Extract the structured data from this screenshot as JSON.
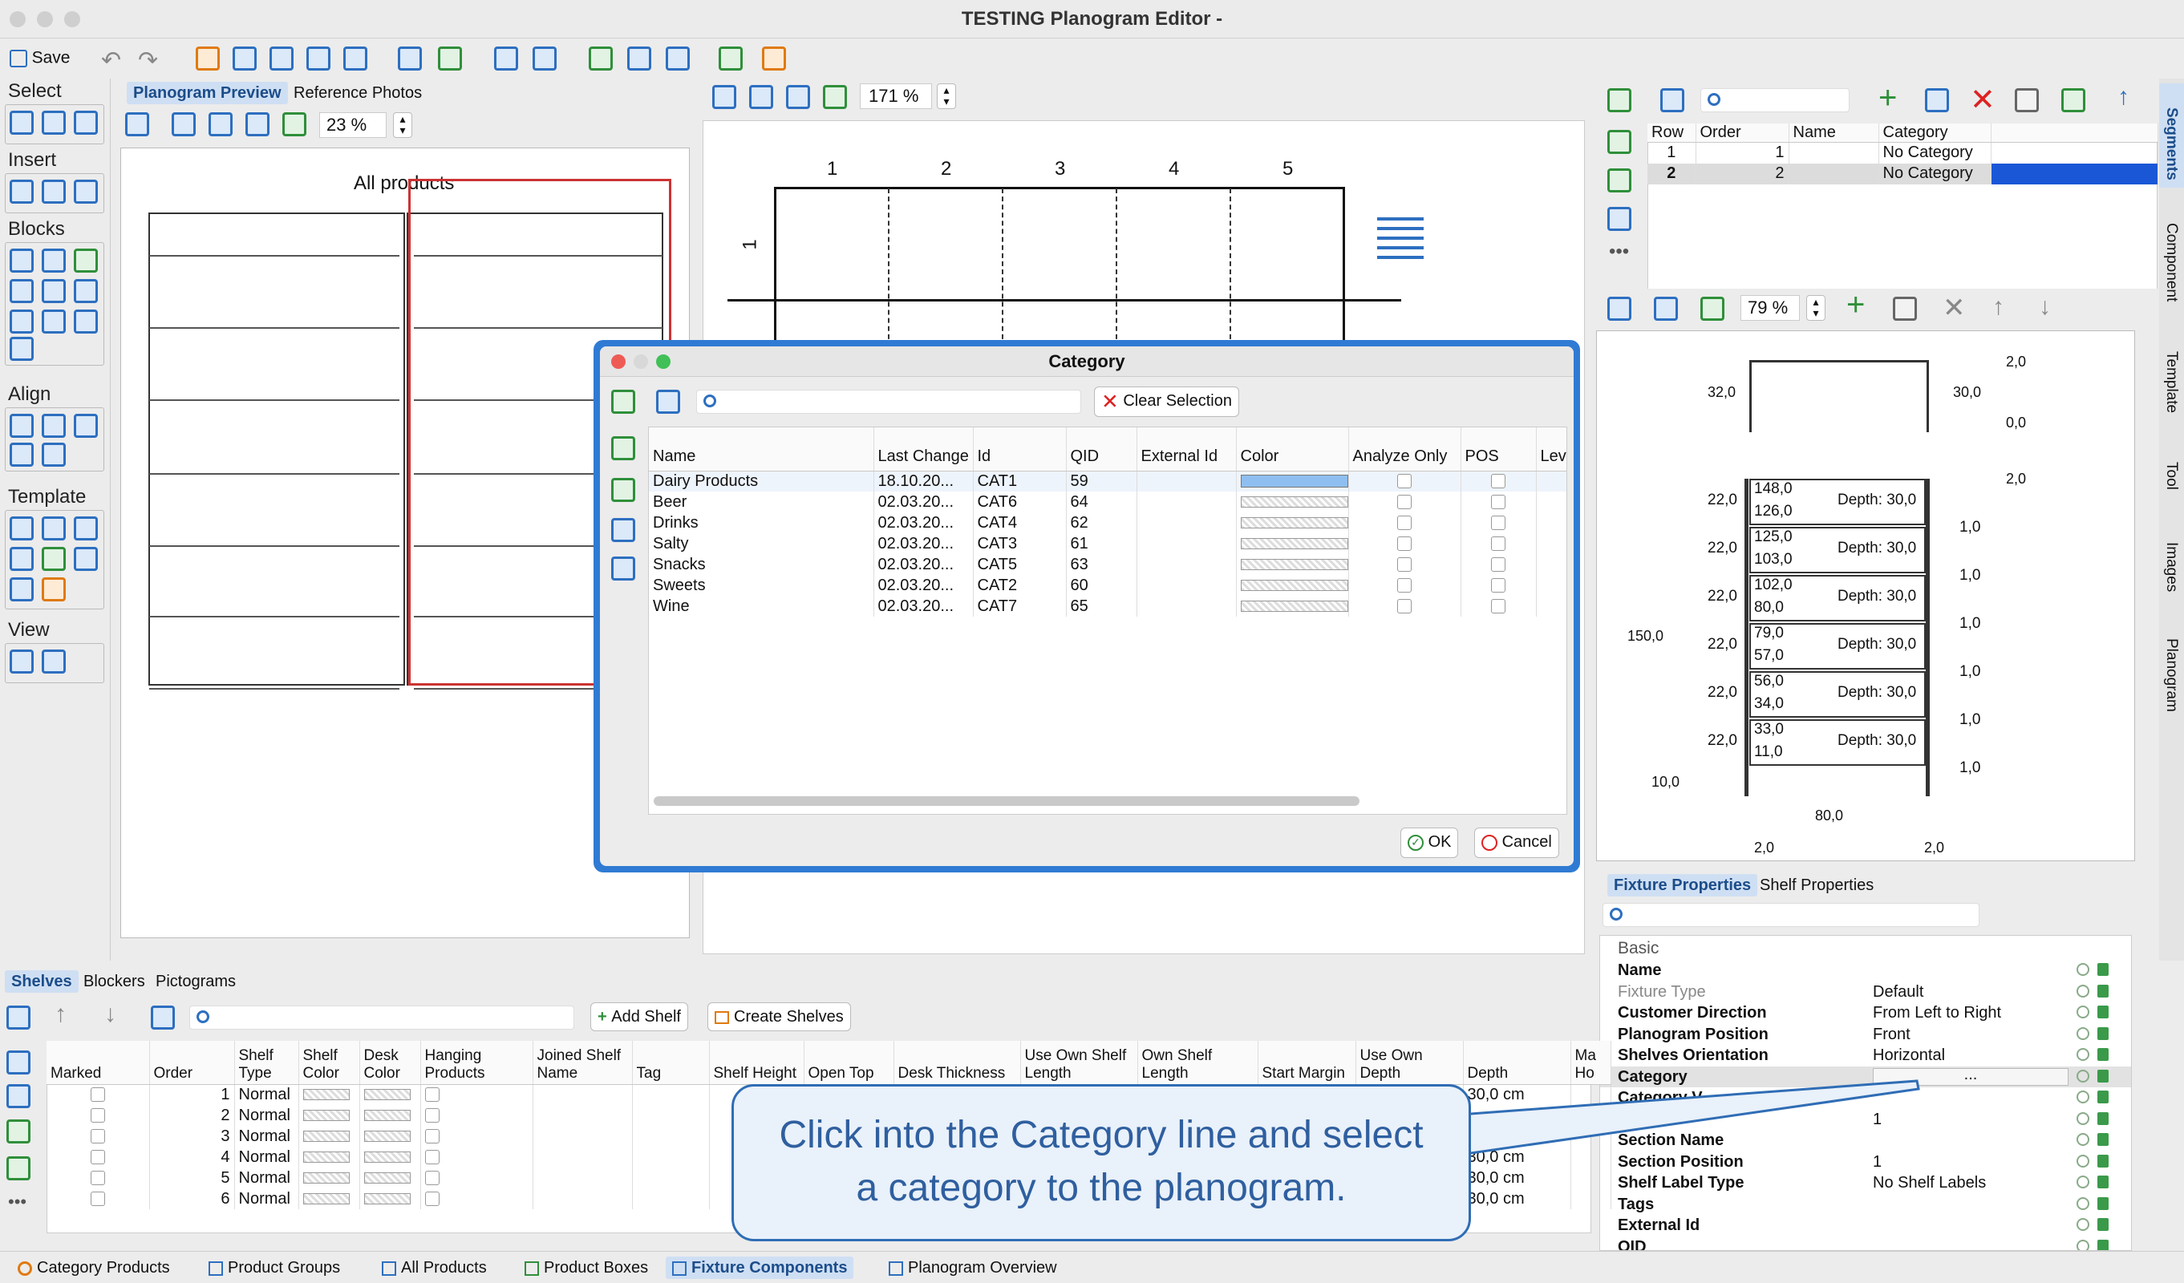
{
  "window": {
    "title": "TESTING Planogram Editor -"
  },
  "toolbar": {
    "save": "Save"
  },
  "left_palette": {
    "groups": [
      "Select",
      "Insert",
      "Blocks",
      "Align",
      "Template",
      "View"
    ]
  },
  "preview": {
    "tabs": [
      "Planogram Preview",
      "Reference Photos"
    ],
    "zoom": "23 %",
    "title": "All products"
  },
  "editor": {
    "zoom": "171 %",
    "columns": [
      "1",
      "2",
      "3",
      "4",
      "5"
    ],
    "row_label": "1"
  },
  "segments": {
    "columns": [
      "Row",
      "Order",
      "Name",
      "Category"
    ],
    "rows": [
      {
        "row": "1",
        "order": "1",
        "name": "",
        "category": "No Category"
      },
      {
        "row": "2",
        "order": "2",
        "name": "",
        "category": "No Category"
      }
    ],
    "color": "#1a57d6"
  },
  "fixture_view": {
    "zoom": "79 %",
    "dims": {
      "top_left": "32,0",
      "top_right": "30,0",
      "right_top": "2,0",
      "right_zero": "0,0",
      "right_mid": "2,0",
      "height": "150,0",
      "bottom_left": "10,0",
      "width": "80,0",
      "bottom_l": "2,0",
      "bottom_r": "2,0"
    },
    "shelves": [
      {
        "left": "22,0",
        "top": "148,0",
        "bottom": "126,0",
        "depth": "Depth: 30,0",
        "gap": "1,0"
      },
      {
        "left": "22,0",
        "top": "125,0",
        "bottom": "103,0",
        "depth": "Depth: 30,0",
        "gap": "1,0"
      },
      {
        "left": "22,0",
        "top": "102,0",
        "bottom": "80,0",
        "depth": "Depth: 30,0",
        "gap": "1,0"
      },
      {
        "left": "22,0",
        "top": "79,0",
        "bottom": "57,0",
        "depth": "Depth: 30,0",
        "gap": "1,0"
      },
      {
        "left": "22,0",
        "top": "56,0",
        "bottom": "34,0",
        "depth": "Depth: 30,0",
        "gap": "1,0"
      },
      {
        "left": "22,0",
        "top": "33,0",
        "bottom": "11,0",
        "depth": "Depth: 30,0",
        "gap": "1,0"
      }
    ]
  },
  "right_side_tabs": [
    "Segments",
    "Component",
    "Template",
    "Tool",
    "Images",
    "Planogram"
  ],
  "dialog": {
    "title": "Category",
    "clear": "Clear Selection",
    "columns": [
      "Name",
      "Last Change",
      "Id",
      "QID",
      "External Id",
      "Color",
      "Analyze Only",
      "POS",
      "Lev"
    ],
    "color_sort": "1",
    "rows": [
      {
        "name": "Dairy Products",
        "last": "18.10.20...",
        "id": "CAT1",
        "qid": "59",
        "color": "#8fbff0"
      },
      {
        "name": "Beer",
        "last": "02.03.20...",
        "id": "CAT6",
        "qid": "64",
        "color": ""
      },
      {
        "name": "Drinks",
        "last": "02.03.20...",
        "id": "CAT4",
        "qid": "62",
        "color": ""
      },
      {
        "name": "Salty",
        "last": "02.03.20...",
        "id": "CAT3",
        "qid": "61",
        "color": ""
      },
      {
        "name": "Snacks",
        "last": "02.03.20...",
        "id": "CAT5",
        "qid": "63",
        "color": ""
      },
      {
        "name": "Sweets",
        "last": "02.03.20...",
        "id": "CAT2",
        "qid": "60",
        "color": ""
      },
      {
        "name": "Wine",
        "last": "02.03.20...",
        "id": "CAT7",
        "qid": "65",
        "color": ""
      }
    ],
    "ok": "OK",
    "cancel": "Cancel"
  },
  "shelves_panel": {
    "tabs": [
      "Shelves",
      "Blockers",
      "Pictograms"
    ],
    "add_shelf": "Add Shelf",
    "create_shelves": "Create Shelves",
    "columns": [
      "Marked",
      "Order",
      "Shelf Type",
      "Shelf Color",
      "Desk Color",
      "Hanging Products",
      "Joined Shelf Name",
      "Tag",
      "Shelf Height",
      "Open Top",
      "Desk Thickness",
      "Use Own Shelf Length",
      "Own Shelf Length",
      "Start Margin",
      "Use Own Depth",
      "Depth",
      "Ma Ho"
    ],
    "rows": [
      {
        "order": "1",
        "type": "Normal",
        "depth": "30,0 cm"
      },
      {
        "order": "2",
        "type": "Normal",
        "depth": ""
      },
      {
        "order": "3",
        "type": "Normal",
        "depth": ""
      },
      {
        "order": "4",
        "type": "Normal",
        "depth": "30,0 cm"
      },
      {
        "order": "5",
        "type": "Normal",
        "depth": "30,0 cm"
      },
      {
        "order": "6",
        "type": "Normal",
        "depth": "30,0 cm"
      }
    ]
  },
  "properties": {
    "tabs": [
      "Fixture Properties",
      "Shelf Properties"
    ],
    "section": "Basic",
    "rows": [
      {
        "k": "Name",
        "v": ""
      },
      {
        "k": "Fixture Type",
        "v": "Default"
      },
      {
        "k": "Customer Direction",
        "v": "From Left to Right"
      },
      {
        "k": "Planogram Position",
        "v": "Front"
      },
      {
        "k": "Shelves Orientation",
        "v": "Horizontal"
      },
      {
        "k": "Category",
        "v": "..."
      },
      {
        "k": "Category V",
        "v": ""
      },
      {
        "k": "Position",
        "v": "1"
      },
      {
        "k": "Section Name",
        "v": ""
      },
      {
        "k": "Section Position",
        "v": "1"
      },
      {
        "k": "Shelf Label Type",
        "v": "No Shelf Labels"
      },
      {
        "k": "Tags",
        "v": ""
      },
      {
        "k": "External Id",
        "v": ""
      },
      {
        "k": "OID",
        "v": ""
      }
    ]
  },
  "callout": {
    "line1": "Click into the Category line and select",
    "line2": "a category to the planogram."
  },
  "bottom_tabs": [
    "Category Products",
    "Product Groups",
    "All Products",
    "Product Boxes",
    "Fixture Components",
    "Planogram Overview"
  ]
}
